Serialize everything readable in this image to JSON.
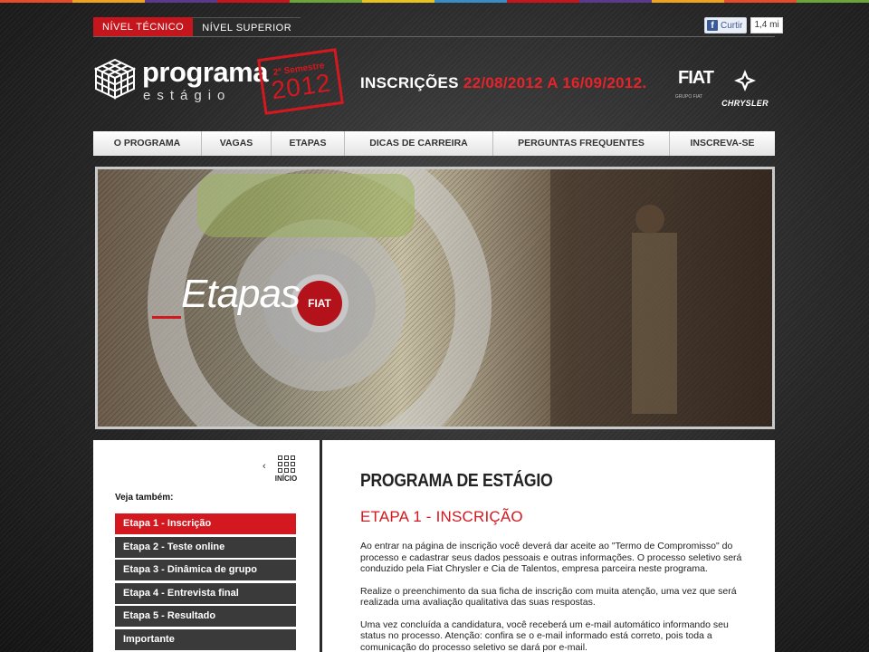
{
  "top_stripe_colors": [
    "#e84b2c",
    "#f0a31e",
    "#5a3a8c",
    "#c4161c",
    "#6ba539",
    "#e8c21e",
    "#3a8cc4",
    "#c4161c",
    "#5a3a8c",
    "#f0a31e",
    "#e84b2c",
    "#6ba539"
  ],
  "level_tabs": {
    "active_label": "NÍVEL TÉCNICO",
    "inactive_label": "NÍVEL SUPERIOR"
  },
  "facebook": {
    "button_label": "Curtir",
    "count": "1,4 mi"
  },
  "logo": {
    "main": "programa",
    "sub": "estágio",
    "semester": "2º Semestre",
    "year": "2012"
  },
  "inscricoes": {
    "label": "INSCRIÇÕES ",
    "dates": "22/08/2012 A 16/09/2012."
  },
  "brands": {
    "fiat": "FIAT",
    "fiat_sub": "GRUPO FIAT",
    "chrysler": "CHRYSLER"
  },
  "nav": {
    "items": [
      {
        "label": "O PROGRAMA"
      },
      {
        "label": "VAGAS"
      },
      {
        "label": "ETAPAS"
      },
      {
        "label": "DICAS DE CARREIRA"
      },
      {
        "label": "PERGUNTAS FREQUENTES"
      },
      {
        "label": "INSCREVA-SE"
      }
    ]
  },
  "banner": {
    "title": "Etapas",
    "badge_text": "FIAT"
  },
  "sidebar": {
    "inicio_label": "INÍCIO",
    "see_also": "Veja também:",
    "steps": [
      {
        "label": "Etapa 1 - Inscrição"
      },
      {
        "label": "Etapa 2 - Teste online"
      },
      {
        "label": "Etapa 3 - Dinâmica de grupo"
      },
      {
        "label": "Etapa 4 - Entrevista final"
      },
      {
        "label": "Etapa 5 - Resultado"
      },
      {
        "label": "Importante"
      }
    ]
  },
  "content": {
    "title": "PROGRAMA DE ESTÁGIO",
    "subtitle": "ETAPA 1 - INSCRIÇÃO",
    "paragraphs": [
      "Ao entrar na página de inscrição você deverá dar aceite ao \"Termo de Compromisso\" do processo e cadastrar seus dados pessoais e outras informações. O processo seletivo será conduzido pela Fiat Chrysler e Cia de Talentos, empresa parceira neste programa.",
      "Realize o preenchimento da sua ficha de inscrição com muita atenção, uma vez que será realizada uma avaliação qualitativa das suas respostas.",
      "Uma vez concluída a candidatura, você receberá um e-mail automático informando seu status no processo. Atenção: confira se o e-mail informado está correto, pois toda a comunicação do processo seletivo se dará por e-mail."
    ]
  },
  "colors": {
    "accent": "#d4181f",
    "step_bg": "#3a3a3a"
  }
}
